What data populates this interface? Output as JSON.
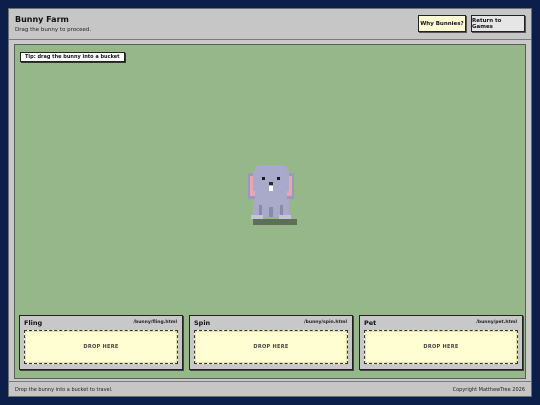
{
  "header": {
    "title": "Bunny Farm",
    "subtitle": "Drag the bunny to proceed.",
    "why_button": "Why Bunnies?",
    "return_button": "Return to Games"
  },
  "field": {
    "tip": "Tip: drag the bunny into a bucket",
    "bunny_icon": "bunny-sprite"
  },
  "buckets": [
    {
      "name": "Fling",
      "path": "/bunny/fling.html",
      "drop_label": "DROP HERE"
    },
    {
      "name": "Spin",
      "path": "/bunny/spin.html",
      "drop_label": "DROP HERE"
    },
    {
      "name": "Pet",
      "path": "/bunny/pet.html",
      "drop_label": "DROP HERE"
    }
  ],
  "footer": {
    "left": "Drop the bunny into a bucket to travel.",
    "right": "Copyright MatthewTree 2026"
  },
  "colors": {
    "background": "#0b1f4a",
    "field": "#96b78a",
    "drop_zone": "#fffdd2",
    "why_button": "#fffbd6",
    "bunny_fur": "#a9a9c9",
    "bunny_ear_inner": "#e7a6b4"
  }
}
